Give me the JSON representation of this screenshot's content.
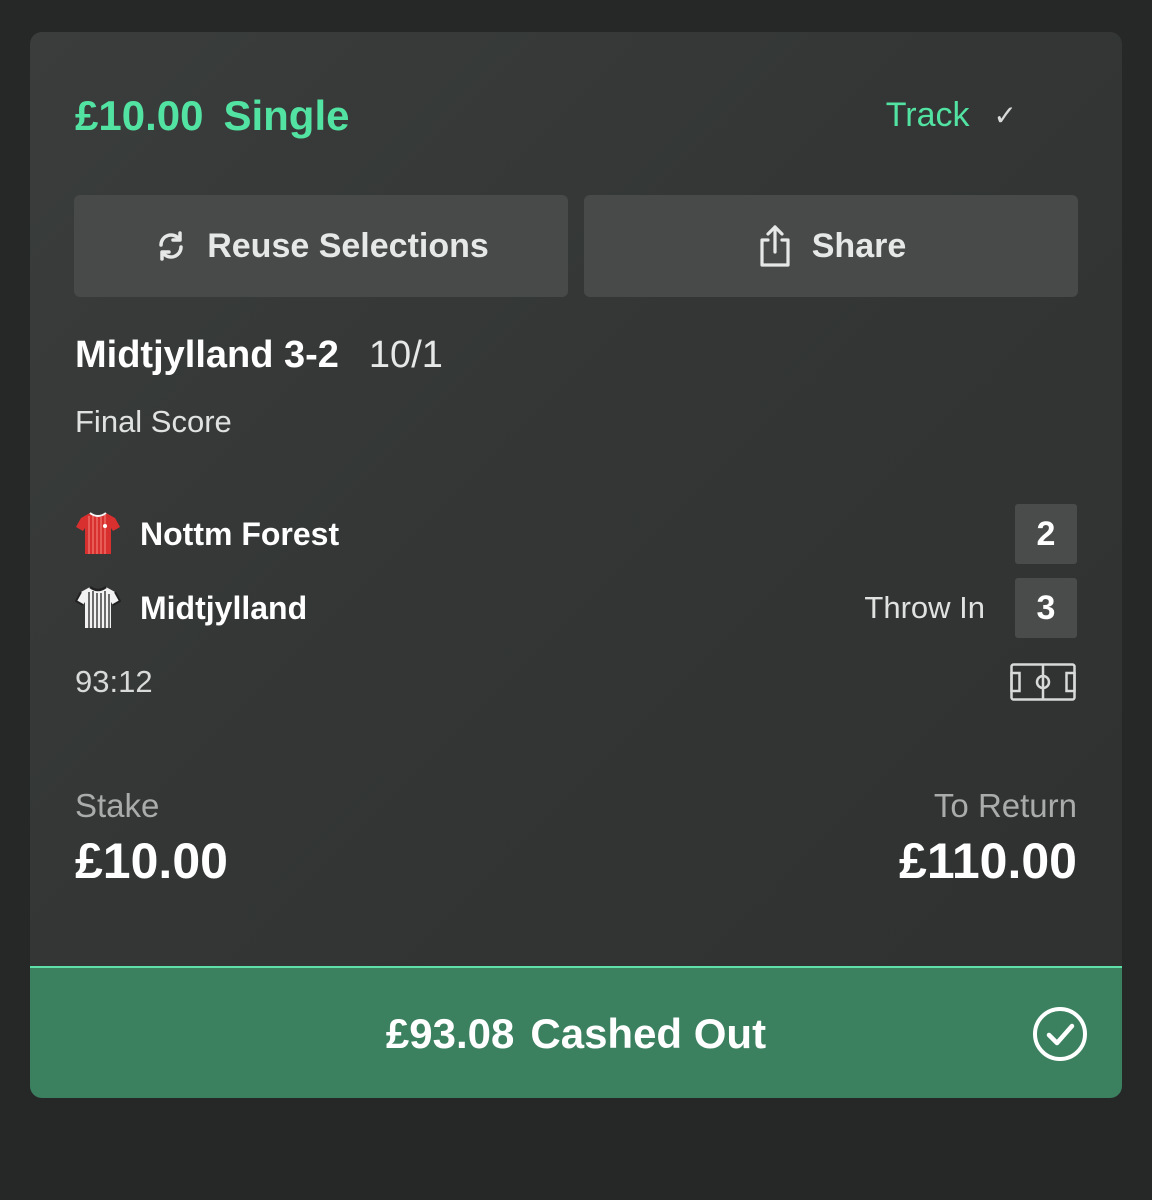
{
  "bet": {
    "stake_amount": "£10.00",
    "type": "Single",
    "track_label": "Track",
    "track_check": "✓"
  },
  "actions": {
    "reuse_label": "Reuse Selections",
    "share_label": "Share"
  },
  "selection": {
    "name": "Midtjylland 3-2",
    "odds": "10/1",
    "market": "Final Score"
  },
  "match": {
    "home": {
      "name": "Nottm Forest",
      "score": "2",
      "kit_color": "#d8302f"
    },
    "away": {
      "name": "Midtjylland",
      "score": "3",
      "kit_color": "#f2f2f2",
      "event": "Throw In"
    },
    "clock": "93:12"
  },
  "summary": {
    "stake_label": "Stake",
    "stake_value": "£10.00",
    "return_label": "To Return",
    "return_value": "£110.00"
  },
  "cashout": {
    "amount": "£93.08",
    "label": "Cashed Out"
  },
  "colors": {
    "accent": "#52e3a2",
    "cashout_bg": "#3b8160"
  },
  "icons": {
    "reuse": "refresh-icon",
    "share": "share-icon",
    "pitch": "pitch-icon",
    "cashed_out": "check-circle-icon"
  }
}
